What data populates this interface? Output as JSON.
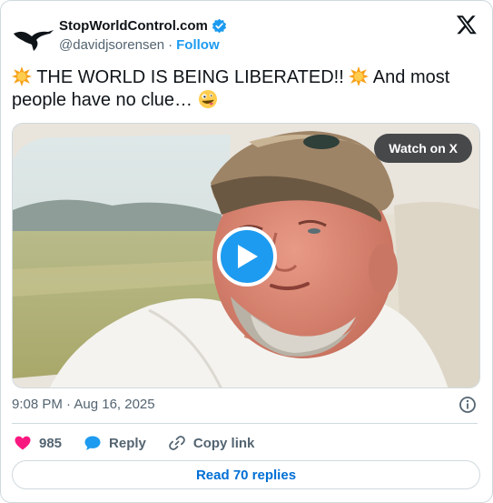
{
  "account": {
    "display_name": "StopWorldControl.com",
    "handle": "@davidjsorensen",
    "separator": "·",
    "follow_label": "Follow",
    "avatar_icon": "eagle-logo",
    "verified_icon": "verified-badge-icon"
  },
  "tweet": {
    "text_part1": "THE WORLD IS BEING LIBERATED!!",
    "text_part2": "And most people have no clue…",
    "emojis": [
      "glowing-star",
      "glowing-star",
      "zany-face"
    ]
  },
  "media": {
    "watch_label": "Watch on X",
    "play_icon": "play-icon"
  },
  "meta": {
    "timestamp": "9:08 PM · Aug 16, 2025",
    "info_icon": "info-icon"
  },
  "actions": {
    "like_count": "985",
    "reply_label": "Reply",
    "copy_label": "Copy link"
  },
  "footer": {
    "read_replies_label": "Read 70 replies"
  },
  "colors": {
    "accent": "#1d9bf0",
    "like": "#f91880",
    "text_secondary": "#536471",
    "border": "#cfd9de"
  }
}
